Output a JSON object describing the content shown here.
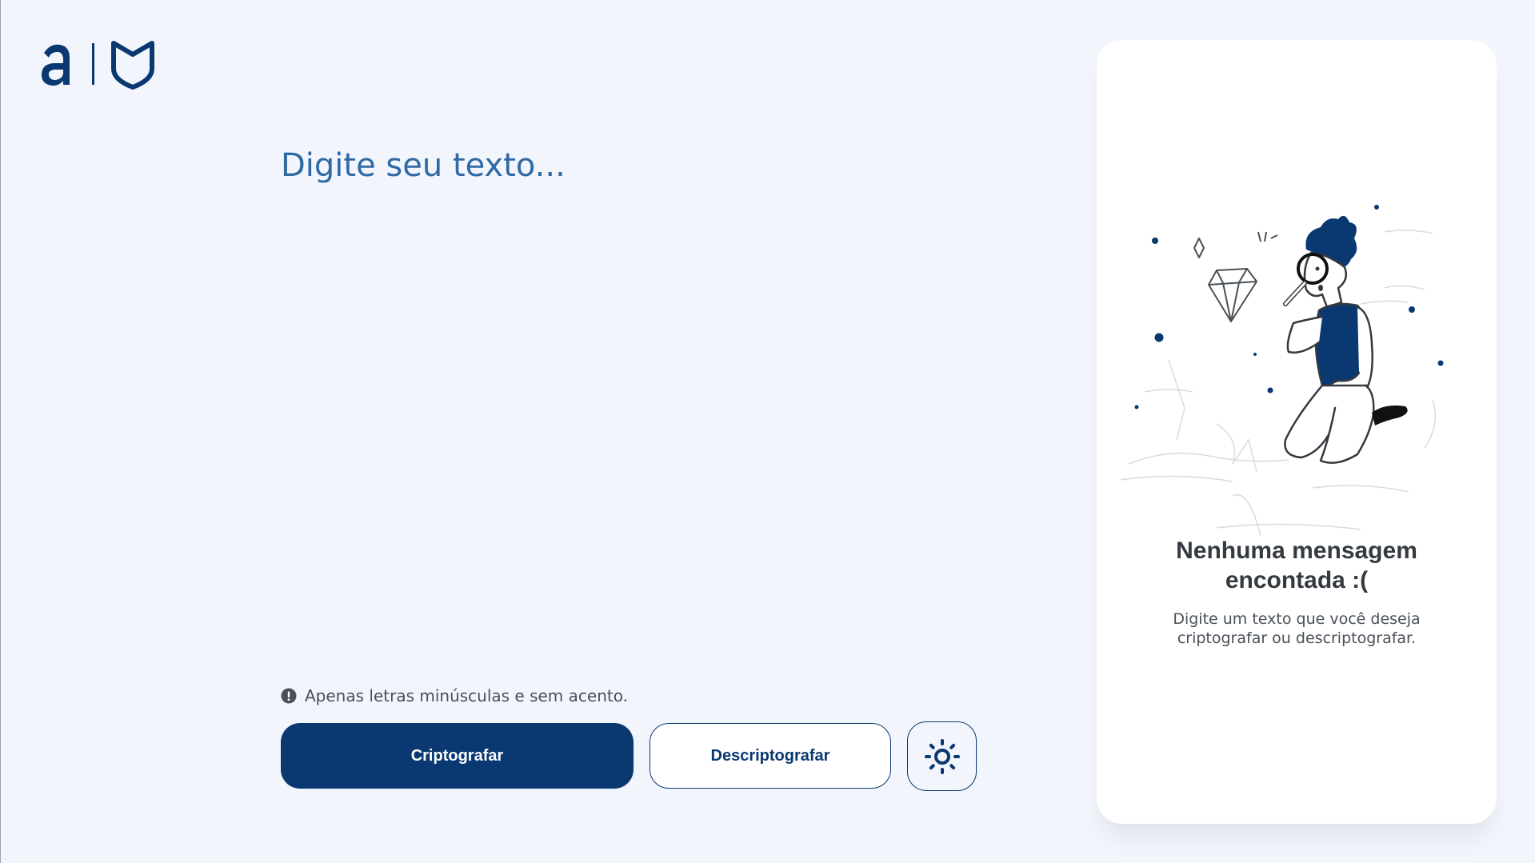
{
  "editor": {
    "placeholder": "Digite seu texto...",
    "value": ""
  },
  "hint": {
    "icon": "exclamation-circle-icon",
    "text": "Apenas letras minúsculas e sem acento."
  },
  "actions": {
    "encrypt_label": "Criptografar",
    "decrypt_label": "Descriptografar",
    "theme_icon": "sun-icon"
  },
  "output_panel": {
    "title": "Nenhuma mensagem encontada :(",
    "description": "Digite um texto que você deseja criptografar ou descriptografar.",
    "illustration": "person-with-magnifier-illustration"
  },
  "colors": {
    "primary": "#0a3871",
    "background": "#f3f5fc",
    "panel": "#ffffff",
    "text_dark": "#343a40",
    "text_muted": "#495057"
  }
}
